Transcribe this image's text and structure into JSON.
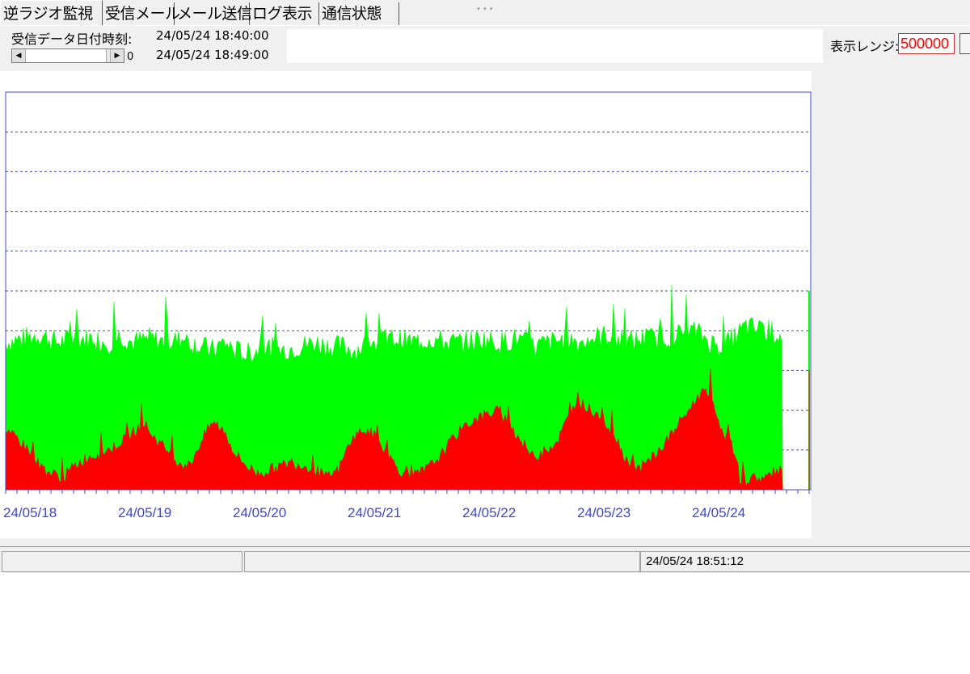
{
  "tabs": [
    {
      "label": "逆ラジオ監視",
      "active": true
    },
    {
      "label": "受信メール",
      "active": false
    },
    {
      "label": "メール送信",
      "active": false
    },
    {
      "label": "ログ表示",
      "active": false
    },
    {
      "label": "通信状態",
      "active": false
    }
  ],
  "header": {
    "datetime_label": "受信データ日付時刻:",
    "datetime_start": "24/05/24 18:40:00",
    "datetime_end": "24/05/24 18:49:00",
    "scroll_value": "0",
    "range_label": "表示レンジ:",
    "range_value": "500000"
  },
  "status_bar": {
    "panel1": "",
    "panel2": "",
    "timestamp": "24/05/24 18:51:12"
  },
  "colors": {
    "series_total": "#00ff00",
    "series_sub": "#ff0000",
    "axis": "#3f48cc",
    "gridline": "#3f48cc",
    "range_text": "#ff0000"
  },
  "chart_data": {
    "type": "area",
    "x_tick_labels": [
      "24/05/18",
      "24/05/19",
      "24/05/20",
      "24/05/21",
      "24/05/22",
      "24/05/23",
      "24/05/24"
    ],
    "x_range_days": [
      0,
      7
    ],
    "y_range_fraction": [
      0,
      1
    ],
    "gridlines": 10,
    "grid": "dashed horizontal",
    "series": [
      {
        "color": "#00ff00",
        "stacked_total": true,
        "x_days": [
          0,
          0.15,
          0.3,
          0.45,
          0.6,
          0.75,
          0.9,
          1.0,
          1.1,
          1.25,
          1.4,
          1.55,
          1.7,
          1.8,
          1.9,
          2.0,
          2.1,
          2.25,
          2.4,
          2.55,
          2.7,
          2.85,
          2.95,
          3.05,
          3.15,
          3.25,
          3.4,
          3.55,
          3.7,
          3.85,
          4.0,
          4.15,
          4.3,
          4.45,
          4.6,
          4.75,
          4.9,
          5.0,
          5.1,
          5.25,
          5.4,
          5.55,
          5.7,
          5.85,
          6.0,
          6.1,
          6.2,
          6.3,
          6.45,
          6.6,
          6.75
        ],
        "values": [
          0.37,
          0.38,
          0.39,
          0.37,
          0.38,
          0.38,
          0.37,
          0.39,
          0.37,
          0.38,
          0.37,
          0.38,
          0.36,
          0.35,
          0.37,
          0.35,
          0.34,
          0.36,
          0.35,
          0.36,
          0.37,
          0.36,
          0.36,
          0.35,
          0.37,
          0.37,
          0.38,
          0.37,
          0.38,
          0.37,
          0.37,
          0.38,
          0.37,
          0.38,
          0.36,
          0.37,
          0.38,
          0.37,
          0.38,
          0.39,
          0.37,
          0.38,
          0.38,
          0.39,
          0.4,
          0.38,
          0.36,
          0.37,
          0.41,
          0.4,
          0.39
        ]
      },
      {
        "color": "#ff0000",
        "x_days": [
          0,
          0.1,
          0.2,
          0.3,
          0.4,
          0.5,
          0.6,
          0.7,
          0.8,
          0.9,
          1.0,
          1.1,
          1.2,
          1.3,
          1.4,
          1.5,
          1.6,
          1.7,
          1.8,
          1.9,
          2.0,
          2.1,
          2.2,
          2.3,
          2.4,
          2.5,
          2.6,
          2.7,
          2.8,
          2.9,
          3.0,
          3.1,
          3.2,
          3.3,
          3.4,
          3.5,
          3.6,
          3.7,
          3.8,
          3.9,
          4.0,
          4.1,
          4.2,
          4.3,
          4.4,
          4.5,
          4.6,
          4.7,
          4.8,
          4.9,
          5.0,
          5.1,
          5.2,
          5.3,
          5.4,
          5.5,
          5.6,
          5.7,
          5.8,
          5.9,
          6.0,
          6.1,
          6.2,
          6.3,
          6.35,
          6.4,
          6.5,
          6.6,
          6.75
        ],
        "values": [
          0.14,
          0.13,
          0.1,
          0.06,
          0.04,
          0.03,
          0.06,
          0.08,
          0.09,
          0.1,
          0.12,
          0.14,
          0.17,
          0.13,
          0.1,
          0.07,
          0.06,
          0.12,
          0.17,
          0.15,
          0.09,
          0.06,
          0.04,
          0.05,
          0.06,
          0.07,
          0.06,
          0.05,
          0.03,
          0.05,
          0.12,
          0.15,
          0.14,
          0.1,
          0.06,
          0.03,
          0.04,
          0.06,
          0.09,
          0.13,
          0.16,
          0.18,
          0.19,
          0.2,
          0.16,
          0.12,
          0.08,
          0.1,
          0.12,
          0.18,
          0.22,
          0.2,
          0.18,
          0.14,
          0.08,
          0.05,
          0.07,
          0.1,
          0.14,
          0.18,
          0.22,
          0.26,
          0.18,
          0.12,
          0.1,
          0.02,
          0.03,
          0.03,
          0.05
        ]
      }
    ]
  }
}
